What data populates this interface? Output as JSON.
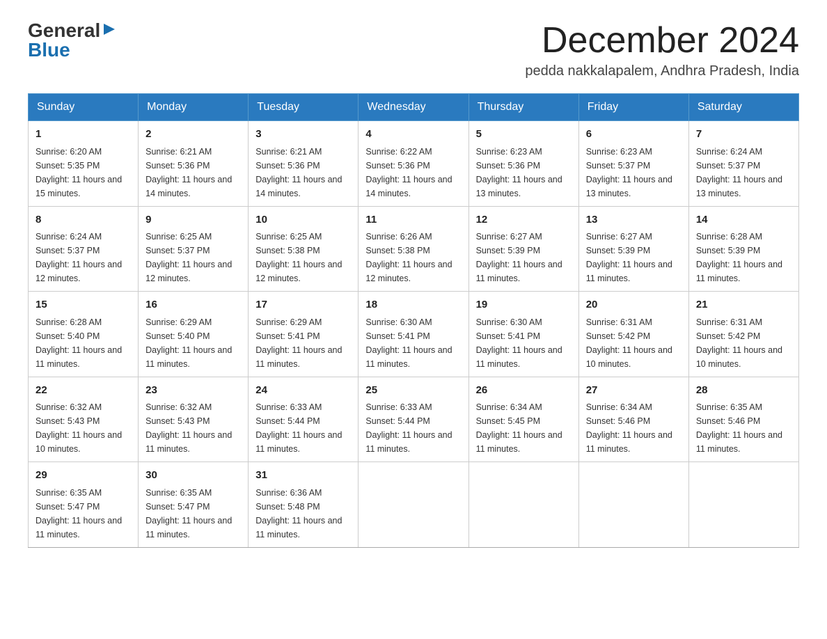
{
  "header": {
    "logo_general": "General",
    "logo_blue": "Blue",
    "month_title": "December 2024",
    "location": "pedda nakkalapalem, Andhra Pradesh, India"
  },
  "weekdays": [
    "Sunday",
    "Monday",
    "Tuesday",
    "Wednesday",
    "Thursday",
    "Friday",
    "Saturday"
  ],
  "weeks": [
    [
      {
        "day": "1",
        "sunrise": "6:20 AM",
        "sunset": "5:35 PM",
        "daylight": "11 hours and 15 minutes."
      },
      {
        "day": "2",
        "sunrise": "6:21 AM",
        "sunset": "5:36 PM",
        "daylight": "11 hours and 14 minutes."
      },
      {
        "day": "3",
        "sunrise": "6:21 AM",
        "sunset": "5:36 PM",
        "daylight": "11 hours and 14 minutes."
      },
      {
        "day": "4",
        "sunrise": "6:22 AM",
        "sunset": "5:36 PM",
        "daylight": "11 hours and 14 minutes."
      },
      {
        "day": "5",
        "sunrise": "6:23 AM",
        "sunset": "5:36 PM",
        "daylight": "11 hours and 13 minutes."
      },
      {
        "day": "6",
        "sunrise": "6:23 AM",
        "sunset": "5:37 PM",
        "daylight": "11 hours and 13 minutes."
      },
      {
        "day": "7",
        "sunrise": "6:24 AM",
        "sunset": "5:37 PM",
        "daylight": "11 hours and 13 minutes."
      }
    ],
    [
      {
        "day": "8",
        "sunrise": "6:24 AM",
        "sunset": "5:37 PM",
        "daylight": "11 hours and 12 minutes."
      },
      {
        "day": "9",
        "sunrise": "6:25 AM",
        "sunset": "5:37 PM",
        "daylight": "11 hours and 12 minutes."
      },
      {
        "day": "10",
        "sunrise": "6:25 AM",
        "sunset": "5:38 PM",
        "daylight": "11 hours and 12 minutes."
      },
      {
        "day": "11",
        "sunrise": "6:26 AM",
        "sunset": "5:38 PM",
        "daylight": "11 hours and 12 minutes."
      },
      {
        "day": "12",
        "sunrise": "6:27 AM",
        "sunset": "5:39 PM",
        "daylight": "11 hours and 11 minutes."
      },
      {
        "day": "13",
        "sunrise": "6:27 AM",
        "sunset": "5:39 PM",
        "daylight": "11 hours and 11 minutes."
      },
      {
        "day": "14",
        "sunrise": "6:28 AM",
        "sunset": "5:39 PM",
        "daylight": "11 hours and 11 minutes."
      }
    ],
    [
      {
        "day": "15",
        "sunrise": "6:28 AM",
        "sunset": "5:40 PM",
        "daylight": "11 hours and 11 minutes."
      },
      {
        "day": "16",
        "sunrise": "6:29 AM",
        "sunset": "5:40 PM",
        "daylight": "11 hours and 11 minutes."
      },
      {
        "day": "17",
        "sunrise": "6:29 AM",
        "sunset": "5:41 PM",
        "daylight": "11 hours and 11 minutes."
      },
      {
        "day": "18",
        "sunrise": "6:30 AM",
        "sunset": "5:41 PM",
        "daylight": "11 hours and 11 minutes."
      },
      {
        "day": "19",
        "sunrise": "6:30 AM",
        "sunset": "5:41 PM",
        "daylight": "11 hours and 11 minutes."
      },
      {
        "day": "20",
        "sunrise": "6:31 AM",
        "sunset": "5:42 PM",
        "daylight": "11 hours and 10 minutes."
      },
      {
        "day": "21",
        "sunrise": "6:31 AM",
        "sunset": "5:42 PM",
        "daylight": "11 hours and 10 minutes."
      }
    ],
    [
      {
        "day": "22",
        "sunrise": "6:32 AM",
        "sunset": "5:43 PM",
        "daylight": "11 hours and 10 minutes."
      },
      {
        "day": "23",
        "sunrise": "6:32 AM",
        "sunset": "5:43 PM",
        "daylight": "11 hours and 11 minutes."
      },
      {
        "day": "24",
        "sunrise": "6:33 AM",
        "sunset": "5:44 PM",
        "daylight": "11 hours and 11 minutes."
      },
      {
        "day": "25",
        "sunrise": "6:33 AM",
        "sunset": "5:44 PM",
        "daylight": "11 hours and 11 minutes."
      },
      {
        "day": "26",
        "sunrise": "6:34 AM",
        "sunset": "5:45 PM",
        "daylight": "11 hours and 11 minutes."
      },
      {
        "day": "27",
        "sunrise": "6:34 AM",
        "sunset": "5:46 PM",
        "daylight": "11 hours and 11 minutes."
      },
      {
        "day": "28",
        "sunrise": "6:35 AM",
        "sunset": "5:46 PM",
        "daylight": "11 hours and 11 minutes."
      }
    ],
    [
      {
        "day": "29",
        "sunrise": "6:35 AM",
        "sunset": "5:47 PM",
        "daylight": "11 hours and 11 minutes."
      },
      {
        "day": "30",
        "sunrise": "6:35 AM",
        "sunset": "5:47 PM",
        "daylight": "11 hours and 11 minutes."
      },
      {
        "day": "31",
        "sunrise": "6:36 AM",
        "sunset": "5:48 PM",
        "daylight": "11 hours and 11 minutes."
      },
      null,
      null,
      null,
      null
    ]
  ],
  "labels": {
    "sunrise": "Sunrise:",
    "sunset": "Sunset:",
    "daylight": "Daylight:"
  }
}
